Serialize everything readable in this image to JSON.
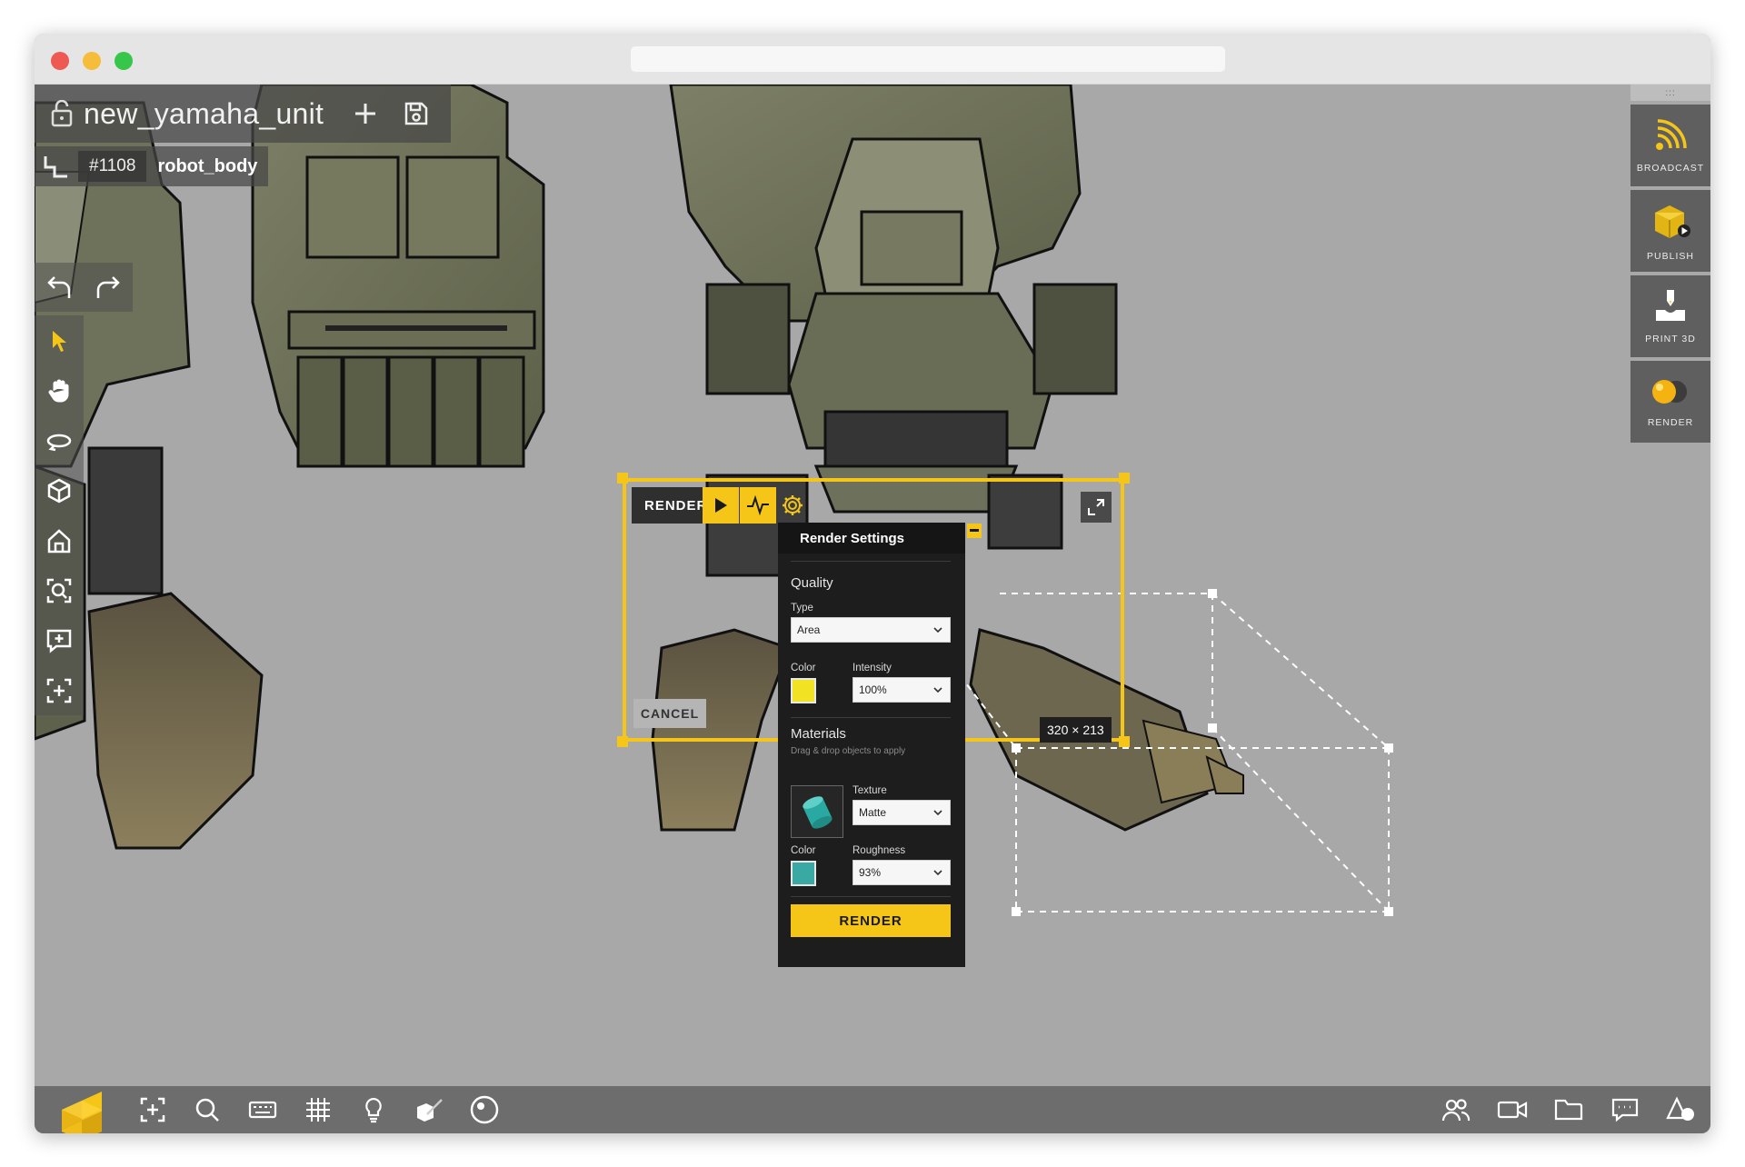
{
  "file": {
    "title": "new_yamaha_unit"
  },
  "breadcrumb": {
    "id": "#1108",
    "name": "robot_body"
  },
  "render_overlay": {
    "tag": "RENDER",
    "cancel_label": "CANCEL",
    "dimensions": "320 × 213"
  },
  "render_settings": {
    "header": "Render Settings",
    "quality": {
      "title": "Quality",
      "type_label": "Type",
      "type_value": "Area",
      "color_label": "Color",
      "color_value": "#f2e224",
      "intensity_label": "Intensity",
      "intensity_value": "100%"
    },
    "materials": {
      "title": "Materials",
      "hint": "Drag & drop objects to apply",
      "texture_label": "Texture",
      "texture_value": "Matte",
      "color_label": "Color",
      "color_value": "#3aa9a4",
      "roughness_label": "Roughness",
      "roughness_value": "93%"
    },
    "render_button": "RENDER"
  },
  "right_rail": [
    {
      "label": "BROADCAST",
      "icon": "broadcast-icon"
    },
    {
      "label": "PUBLISH",
      "icon": "publish-icon"
    },
    {
      "label": "PRINT 3D",
      "icon": "print-3d-icon"
    },
    {
      "label": "RENDER",
      "icon": "render-spheres-icon"
    }
  ],
  "colors": {
    "accent": "#f5c518",
    "panel_bg": "#1d1d1d",
    "viewport_bg": "#a8a8a8"
  }
}
